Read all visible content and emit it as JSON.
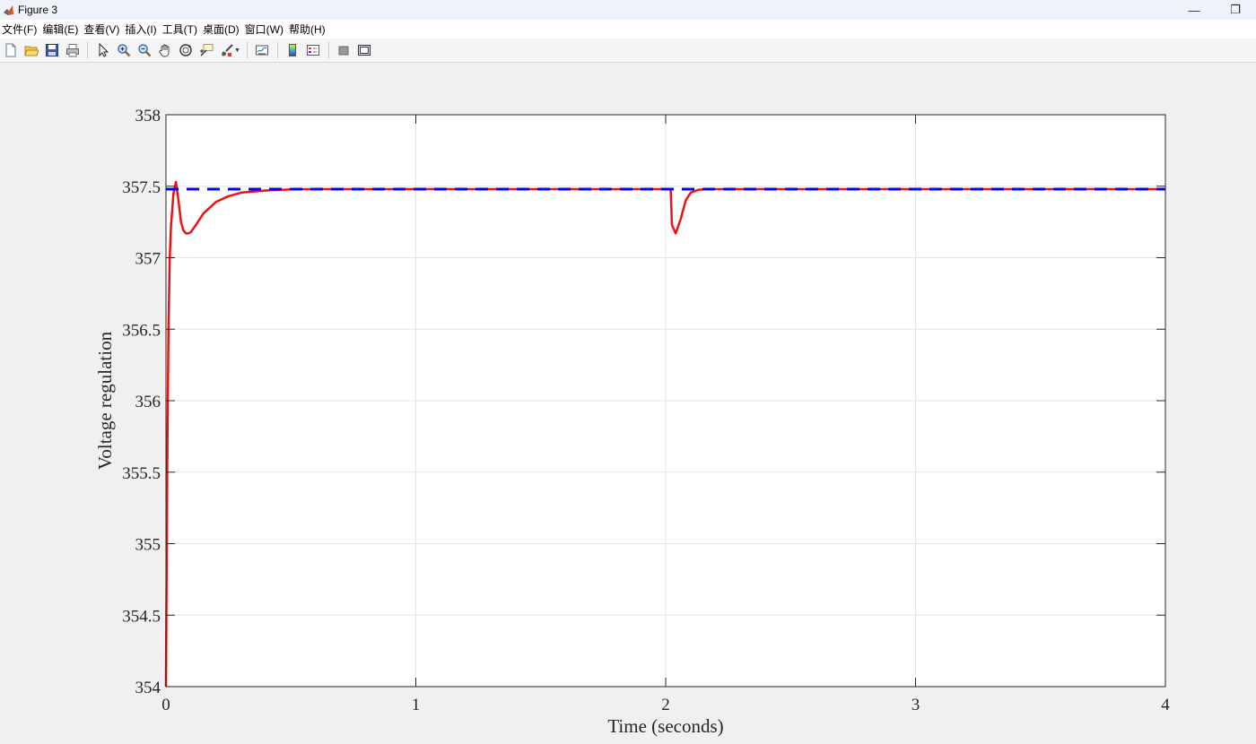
{
  "window": {
    "title": "Figure 3",
    "minimize_glyph": "—",
    "restore_glyph": "❐"
  },
  "menu": [
    {
      "label": "文件(F)",
      "name": "menu-file"
    },
    {
      "label": "编辑(E)",
      "name": "menu-edit"
    },
    {
      "label": "查看(V)",
      "name": "menu-view"
    },
    {
      "label": "插入(I)",
      "name": "menu-insert"
    },
    {
      "label": "工具(T)",
      "name": "menu-tools"
    },
    {
      "label": "桌面(D)",
      "name": "menu-desktop"
    },
    {
      "label": "窗口(W)",
      "name": "menu-window"
    },
    {
      "label": "帮助(H)",
      "name": "menu-help"
    }
  ],
  "toolbar": [
    "new-figure-icon",
    "open-file-icon",
    "save-icon",
    "print-icon",
    "pointer-icon",
    "zoom-in-icon",
    "zoom-out-icon",
    "pan-hand-icon",
    "rotate-3d-icon",
    "data-cursor-icon",
    "brush-icon",
    "link-plot-icon",
    "colorbar-icon",
    "legend-icon",
    "hide-plot-tools-icon",
    "show-plot-tools-icon"
  ],
  "colors": {
    "reference_line": "#0000ff",
    "response_line": "#ee1111",
    "axes_background": "#ffffff",
    "figure_background": "#f0f0f0"
  },
  "chart_data": {
    "type": "line",
    "title": "",
    "xlabel": "Time (seconds)",
    "ylabel": "Voltage regulation",
    "xlim": [
      0,
      4
    ],
    "ylim": [
      354,
      358
    ],
    "xticks": [
      0,
      1,
      2,
      3,
      4
    ],
    "xtick_labels": [
      "0",
      "1",
      "2",
      "3",
      "4"
    ],
    "yticks": [
      354,
      354.5,
      355,
      355.5,
      356,
      356.5,
      357,
      357.5,
      358
    ],
    "ytick_labels": [
      "354",
      "354.5",
      "355",
      "355.5",
      "356",
      "356.5",
      "357",
      "357.5",
      "358"
    ],
    "grid": true,
    "legend": "none",
    "series": [
      {
        "style": "dashed",
        "color": "#0000ff",
        "x": [
          0,
          4
        ],
        "y": [
          357.48,
          357.48
        ]
      },
      {
        "style": "solid",
        "color": "#ee1111",
        "x": [
          0.0,
          0.005,
          0.01,
          0.015,
          0.02,
          0.03,
          0.04,
          0.05,
          0.06,
          0.07,
          0.08,
          0.09,
          0.1,
          0.12,
          0.15,
          0.2,
          0.25,
          0.3,
          0.4,
          0.5,
          0.6,
          1.0,
          1.5,
          2.0,
          2.02,
          2.025,
          2.04,
          2.06,
          2.08,
          2.1,
          2.13,
          2.17,
          2.25,
          3.0,
          4.0
        ],
        "y": [
          354.0,
          355.5,
          356.5,
          357.0,
          357.22,
          357.45,
          357.53,
          357.4,
          357.25,
          357.19,
          357.17,
          357.17,
          357.18,
          357.23,
          357.31,
          357.39,
          357.43,
          357.455,
          357.47,
          357.478,
          357.48,
          357.48,
          357.48,
          357.48,
          357.48,
          357.23,
          357.17,
          357.27,
          357.4,
          357.455,
          357.475,
          357.48,
          357.48,
          357.48,
          357.48
        ]
      }
    ]
  }
}
